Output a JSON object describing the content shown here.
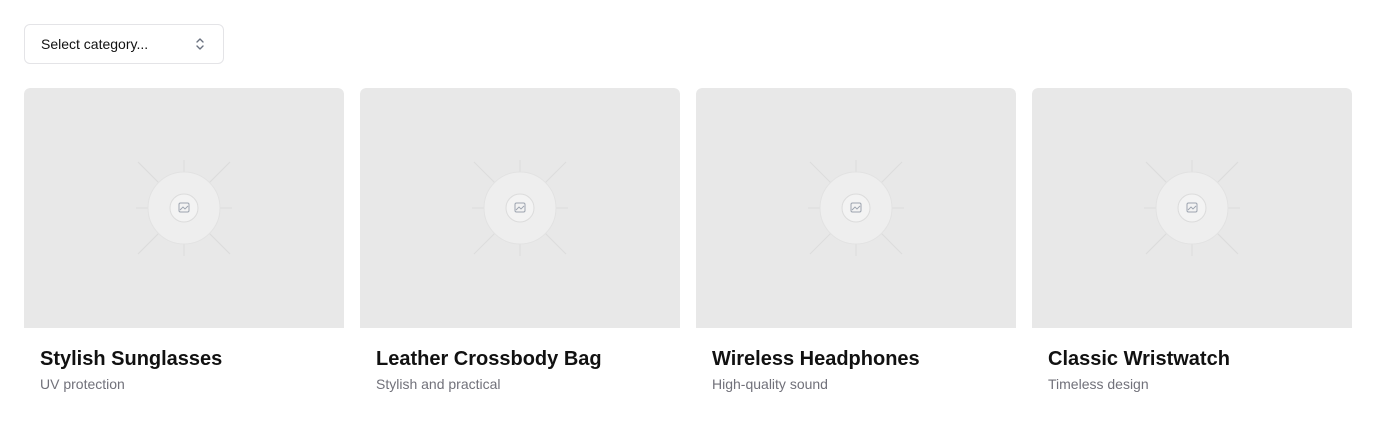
{
  "select": {
    "placeholder": "Select category..."
  },
  "products": [
    {
      "title": "Stylish Sunglasses",
      "description": "UV protection"
    },
    {
      "title": "Leather Crossbody Bag",
      "description": "Stylish and practical"
    },
    {
      "title": "Wireless Headphones",
      "description": "High-quality sound"
    },
    {
      "title": "Classic Wristwatch",
      "description": "Timeless design"
    }
  ],
  "icons": {
    "select": "chevron-up-down-icon",
    "placeholder": "image-placeholder-icon"
  },
  "colors": {
    "thumb_bg": "#e8e8e8",
    "muted_text": "#71717a",
    "border": "#e4e4e7"
  }
}
